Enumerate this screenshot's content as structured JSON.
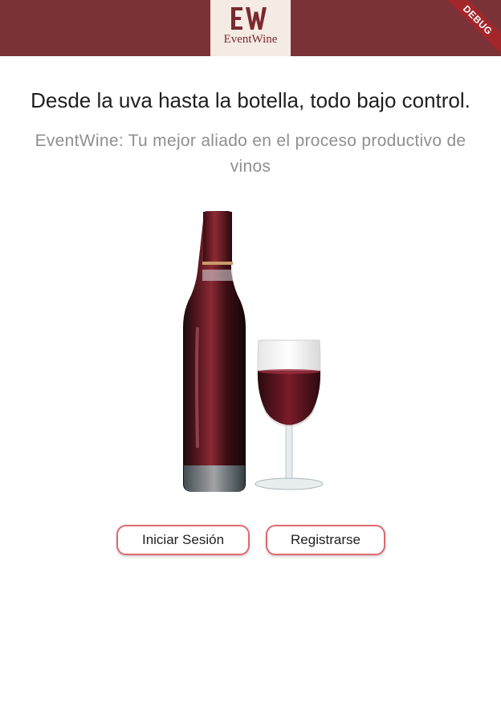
{
  "appbar": {
    "logo_text": "EventWine",
    "logo_mark": "EW",
    "debug_label": "DEBUG",
    "color": "#7a3236"
  },
  "hero": {
    "headline": "Desde la uva hasta la botella, todo bajo control.",
    "subtitle": "EventWine: Tu mejor aliado en el proceso productivo de vinos",
    "image_icon": "wine-bottle-and-glass"
  },
  "actions": {
    "login_label": "Iniciar Sesión",
    "register_label": "Registrarse",
    "accent": "#e0686e"
  }
}
